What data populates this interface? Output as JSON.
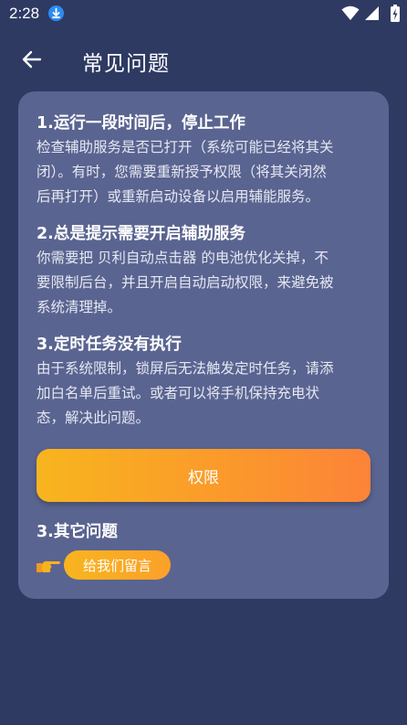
{
  "status_bar": {
    "time": "2:28",
    "icons": [
      "download-icon",
      "wifi-icon",
      "signal-icon",
      "battery-icon"
    ]
  },
  "header": {
    "back_icon": "arrow-left-icon",
    "title": "常见问题"
  },
  "faq": {
    "sections": [
      {
        "title": "1.运行一段时间后，停止工作",
        "lines": [
          "检查辅助服务是否已打开（系统可能已经将其关",
          "闭）。有时，您需要重新授予权限（将其关闭然",
          "后再打开）或重新启动设备以启用辅能服务。"
        ]
      },
      {
        "title": "2.总是提示需要开启辅助服务",
        "lines": [
          "你需要把 贝利自动点击器 的电池优化关掉，不",
          "要限制后台，并且开启自动启动权限，来避免被",
          "系统清理掉。"
        ]
      },
      {
        "title": "3.定时任务没有执行",
        "lines": [
          "由于系统限制，锁屏后无法触发定时任务，请添",
          "加白名单后重试。或者可以将手机保持充电状",
          "态，解决此问题。"
        ]
      }
    ],
    "permission_button": "权限",
    "other_title": "3.其它问题",
    "pointer_icon": "pointing-hand-icon",
    "feedback_button": "给我们留言"
  },
  "colors": {
    "background": "#2f3a63",
    "card": "#5a6490",
    "accent_start": "#f8b51e",
    "accent_end": "#fc8338"
  }
}
